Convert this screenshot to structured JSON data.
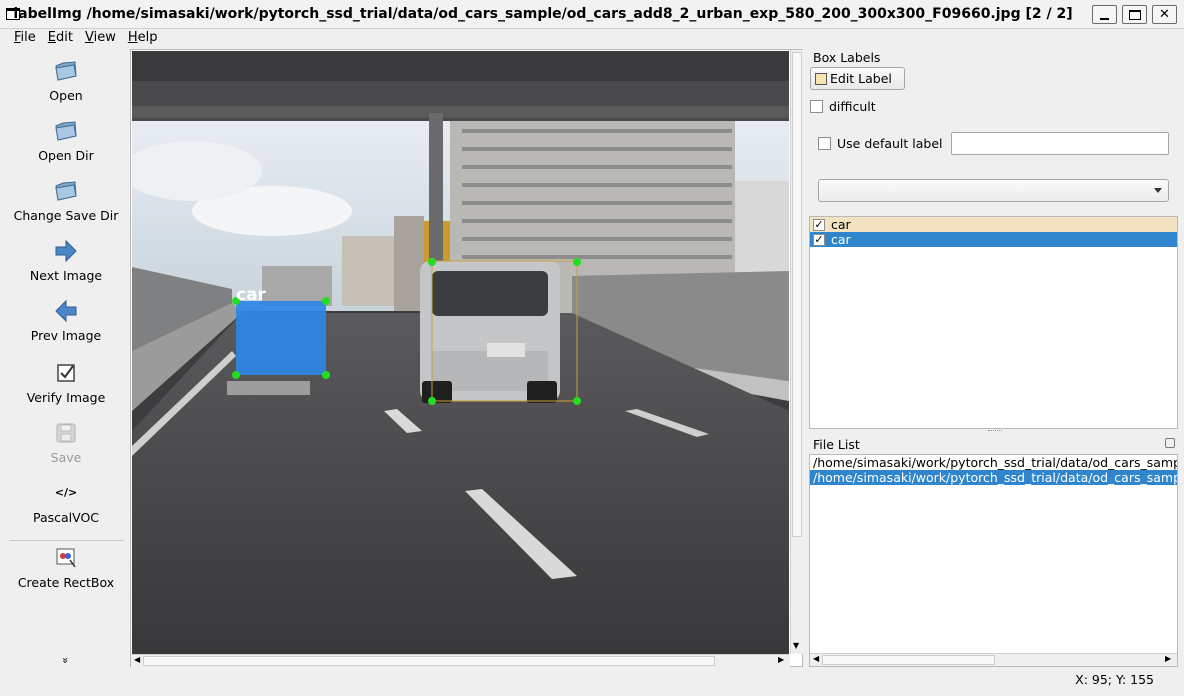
{
  "window": {
    "title": "labelImg /home/simasaki/work/pytorch_ssd_trial/data/od_cars_sample/od_cars_add8_2_urban_exp_580_200_300x300_F09660.jpg [2 / 2]",
    "close_glyph": "✕"
  },
  "menu": {
    "file": "File",
    "edit": "Edit",
    "view": "View",
    "help": "Help"
  },
  "toolbar": {
    "open": "Open",
    "open_dir": "Open Dir",
    "change_save_dir": "Change Save Dir",
    "next_image": "Next Image",
    "prev_image": "Prev Image",
    "verify_image": "Verify Image",
    "save": "Save",
    "format_glyph": "</>",
    "format": "PascalVOC",
    "create_rectbox": "Create RectBox",
    "more_glyph": "»"
  },
  "canvas": {
    "box_label": "car",
    "boxes": [
      {
        "label": "car",
        "selected": true
      },
      {
        "label": "car",
        "selected": false
      }
    ]
  },
  "dock": {
    "box_labels_title": "Box Labels",
    "edit_label": "Edit Label",
    "difficult": "difficult",
    "use_default_label": "Use default label",
    "default_label_value": "",
    "combo_value": "",
    "labels": [
      {
        "text": "car",
        "checked": true,
        "check_glyph": "✓"
      },
      {
        "text": "car",
        "checked": true,
        "check_glyph": "✓"
      }
    ],
    "file_list_title": "File List",
    "files": [
      "/home/simasaki/work/pytorch_ssd_trial/data/od_cars_sample",
      "/home/simasaki/work/pytorch_ssd_trial/data/od_cars_sample"
    ]
  },
  "status": {
    "coords": "X: 95; Y: 155"
  },
  "colors": {
    "selection": "#2f86cd",
    "box_fill": "#2f86e6",
    "handle": "#22dd22",
    "box_outline": "#c8a23a"
  }
}
